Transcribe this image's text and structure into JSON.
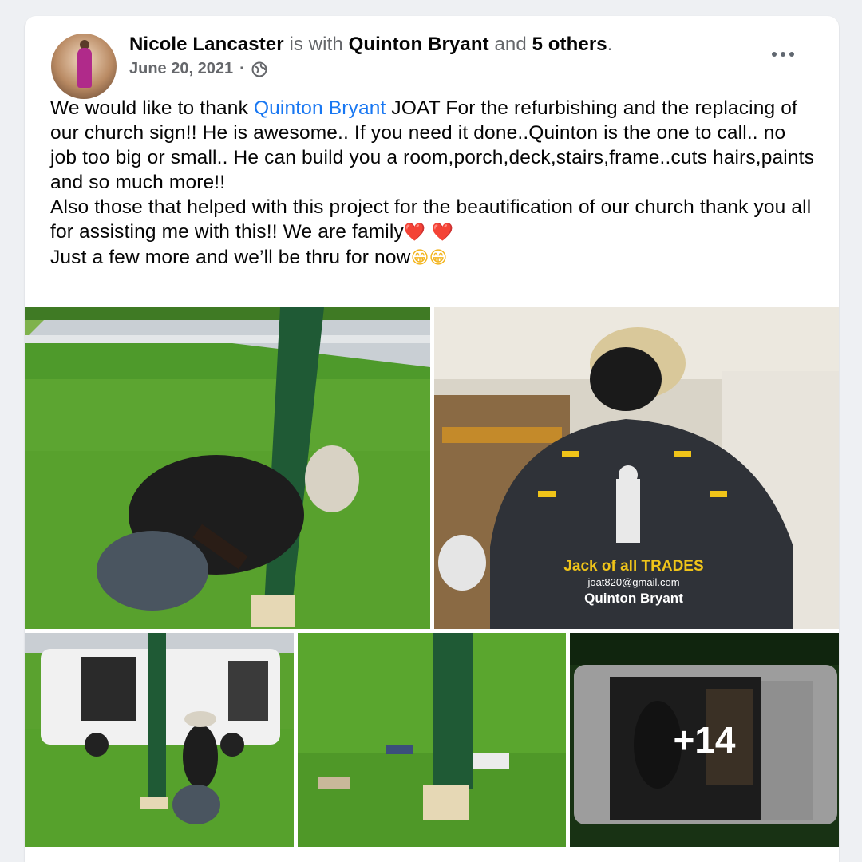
{
  "post": {
    "author": "Nicole Lancaster",
    "with_text": " is with ",
    "tagged": "Quinton Bryant",
    "and_text": " and ",
    "others": "5 others",
    "period": ".",
    "date": "June 20, 2021",
    "separator": "·",
    "privacy_icon": "globe-icon",
    "more_icon": "more-options-icon"
  },
  "text": {
    "l1_a": "We would like to thank ",
    "l1_link": "Quinton Bryant",
    "l1_b": " JOAT For the refurbishing and the replacing of our church sign!! He is awesome.. If you need it done..Quinton is the one to call.. no job too big or small.. He can build you a room,porch,deck,stairs,frame..cuts hairs,paints and so much more!!",
    "l2": "Also those that helped with this project for the beautification of our church thank you all for assisting me with this!! We are family",
    "l2_emoji": "❤️ ❤️",
    "l3": "Just a few more and we’ll be thru for now",
    "l3_emoji": "😁😁"
  },
  "photos": {
    "shirt_line1": "Jack of all TRADES",
    "shirt_line2": "joat820@gmail.com",
    "shirt_line3": "Quinton Bryant",
    "more_count": "+14"
  },
  "colors": {
    "link": "#1877f2",
    "grass": "#5fa52f",
    "post_green": "#1f5a35"
  }
}
